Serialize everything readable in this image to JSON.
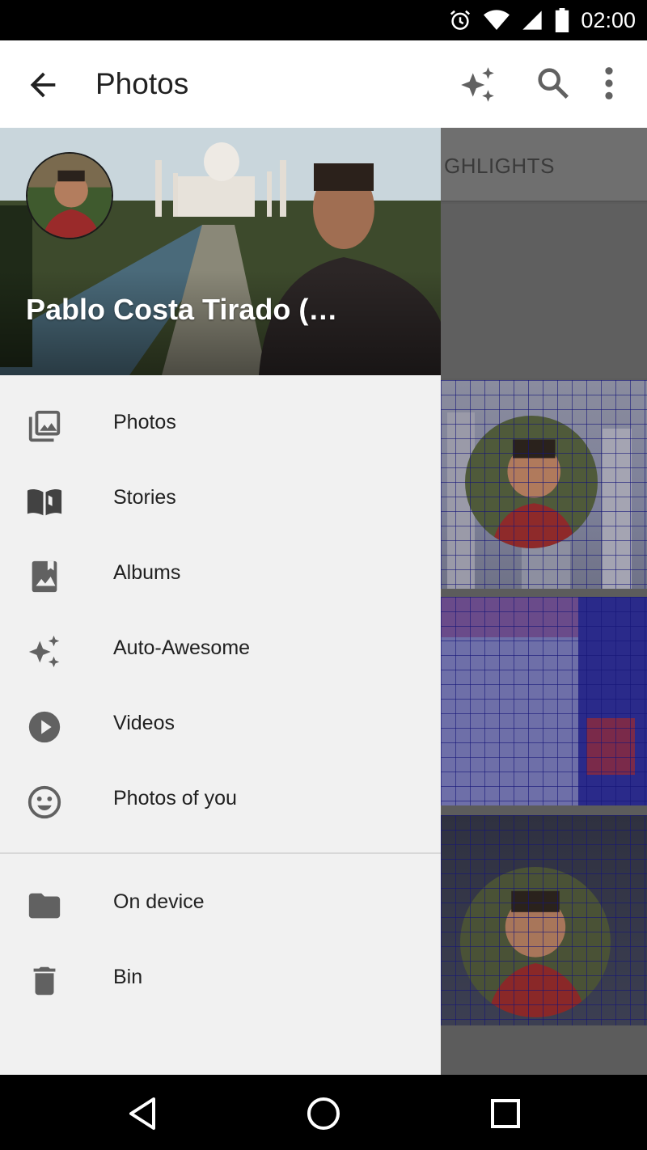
{
  "status_bar": {
    "time": "02:00"
  },
  "app_bar": {
    "title": "Photos"
  },
  "background": {
    "tab_label": "GHLIGHTS"
  },
  "drawer": {
    "account_name": "Pablo Costa Tirado (…",
    "items": [
      {
        "label": "Photos",
        "icon": "photo-library-icon"
      },
      {
        "label": "Stories",
        "icon": "book-icon"
      },
      {
        "label": "Albums",
        "icon": "album-icon"
      },
      {
        "label": "Auto-Awesome",
        "icon": "sparkle-icon"
      },
      {
        "label": "Videos",
        "icon": "play-circle-icon"
      },
      {
        "label": "Photos of you",
        "icon": "smiley-face-icon"
      }
    ],
    "secondary_items": [
      {
        "label": "On device",
        "icon": "folder-icon"
      },
      {
        "label": "Bin",
        "icon": "trash-icon"
      }
    ]
  },
  "colors": {
    "app_bar": "#ffffff",
    "drawer": "#f1f1f1",
    "text_primary": "#212121",
    "icon": "#616161",
    "scrim": "#5c5c5c"
  }
}
